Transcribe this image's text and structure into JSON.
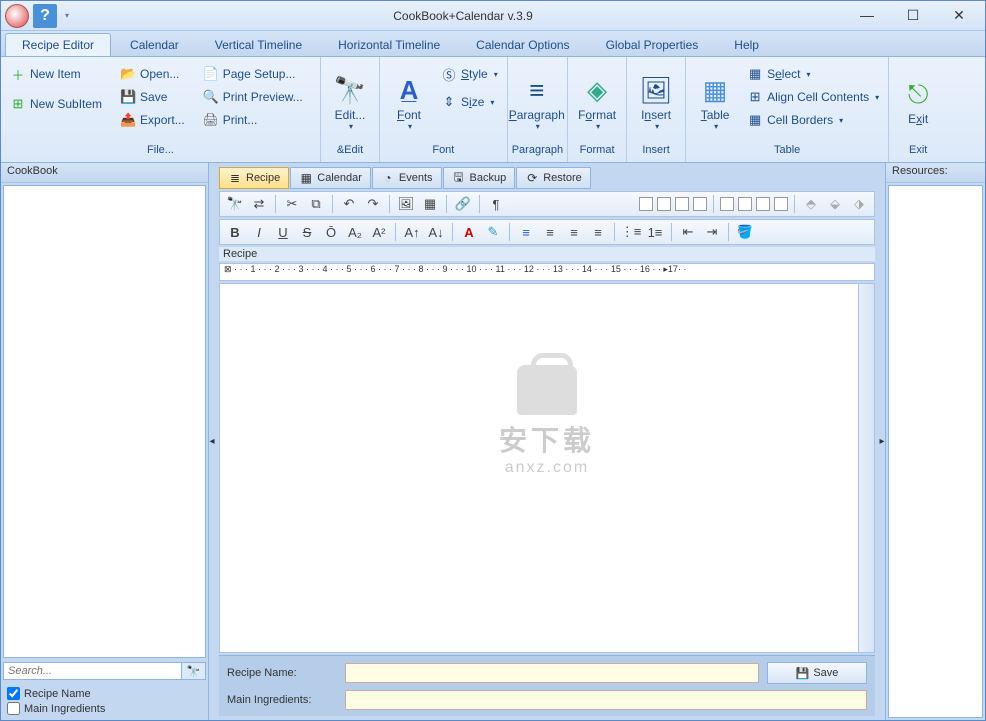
{
  "window": {
    "title": "CookBook+Calendar v.3.9",
    "min": "—",
    "max": "☐",
    "close": "✕"
  },
  "tabs": {
    "items": [
      "Recipe Editor",
      "Calendar",
      "Vertical Timeline",
      "Horizontal Timeline",
      "Calendar Options",
      "Global Properties",
      "Help"
    ],
    "active": 0
  },
  "ribbon": {
    "new_item": "New Item",
    "new_subitem": "New SubItem",
    "open": "Open...",
    "save": "Save",
    "export": "Export...",
    "page_setup": "Page Setup...",
    "print_preview": "Print Preview...",
    "print": "Print...",
    "file_group": "File...",
    "edit": "Edit...",
    "edit_group": "&Edit",
    "font": "Font",
    "style": "Style",
    "size": "Size",
    "font_group": "Font",
    "paragraph": "Paragraph",
    "paragraph_group": "Paragraph",
    "format": "Format",
    "format_group": "Format",
    "insert": "Insert",
    "insert_group": "Insert",
    "table": "Table",
    "select": "Select",
    "align_cell": "Align Cell Contents",
    "cell_borders": "Cell Borders",
    "table_group": "Table",
    "exit": "Exit",
    "exit_group": "Exit"
  },
  "left": {
    "title": "CookBook",
    "search_placeholder": "Search...",
    "chk_recipe": "Recipe Name",
    "chk_ingredients": "Main Ingredients"
  },
  "doctabs": {
    "items": [
      {
        "icon": "≣",
        "label": "Recipe"
      },
      {
        "icon": "▦",
        "label": "Calendar"
      },
      {
        "icon": "◔",
        "label": "Events"
      },
      {
        "icon": "🖫",
        "label": "Backup"
      },
      {
        "icon": "⟳",
        "label": "Restore"
      }
    ],
    "active": 0
  },
  "doc": {
    "label": "Recipe",
    "ruler_marks": "⊠ · · · 1 · · · 2 · · · 3 · · · 4 · · · 5 · · · 6 · · · 7 · · · 8 · · · 9 · · · 10 · · · 11 · · · 12 · · · 13 · · · 14 · · · 15 · · · 16 · · ▸17· ·"
  },
  "watermark": {
    "chinese": "安下载",
    "url": "anxz.com"
  },
  "form": {
    "recipe_name_label": "Recipe Name:",
    "main_ingredients_label": "Main Ingredients:",
    "save": "Save"
  },
  "right": {
    "title": "Resources:"
  }
}
